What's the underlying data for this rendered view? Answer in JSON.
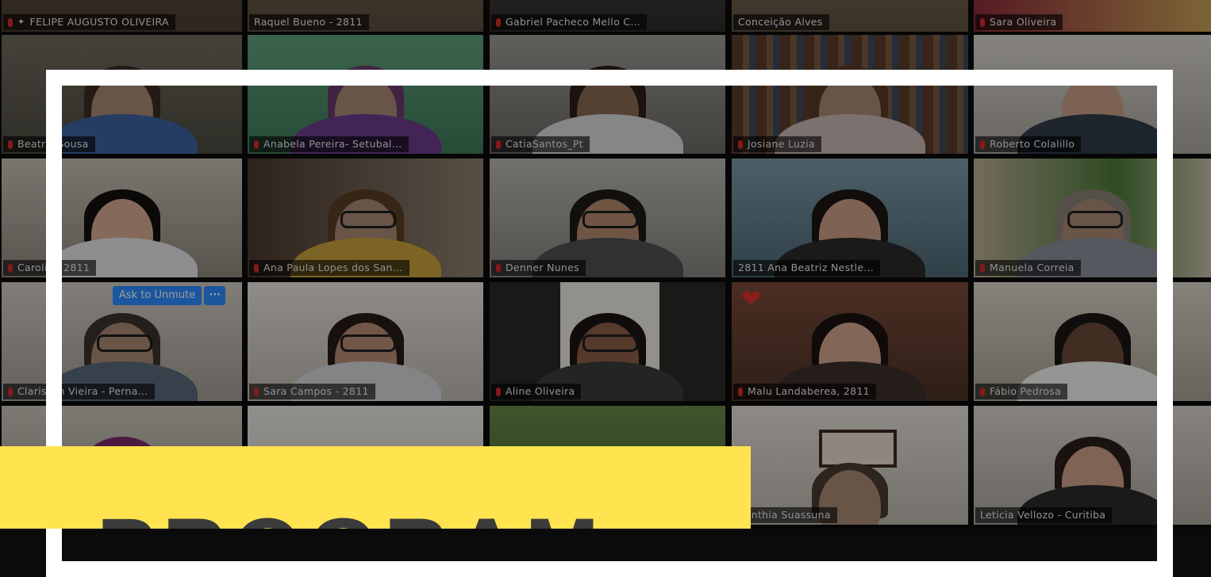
{
  "participants": [
    {
      "name": "FELIPE AUGUSTO OLIVEIRA",
      "muted": true,
      "pinned": true,
      "active": true
    },
    {
      "name": "Raquel Bueno - 2811",
      "muted": false
    },
    {
      "name": "Gabriel Pacheco Mello C...",
      "muted": true
    },
    {
      "name": "Conceição Alves",
      "muted": false
    },
    {
      "name": "Sara Oliveira",
      "muted": true
    },
    {
      "name": "Beatriz Sousa",
      "muted": true
    },
    {
      "name": "Anabela Pereira- Setubal...",
      "muted": true
    },
    {
      "name": "CatiaSantos_Pt",
      "muted": true
    },
    {
      "name": "Josiane Luzia",
      "muted": true
    },
    {
      "name": "Roberto Colalillo",
      "muted": true
    },
    {
      "name": "Carolina 2811",
      "muted": true
    },
    {
      "name": "Ana Paula Lopes dos San...",
      "muted": true
    },
    {
      "name": "Denner Nunes",
      "muted": true
    },
    {
      "name": "2811 Ana Beatriz Nestle...",
      "muted": false
    },
    {
      "name": "Manuela Correia",
      "muted": true
    },
    {
      "name": "Clarisson Vieira - Perna...",
      "muted": true
    },
    {
      "name": "Sara Campos - 2811",
      "muted": true
    },
    {
      "name": "Aline Oliveira",
      "muted": true
    },
    {
      "name": "Malu Landaberea, 2811",
      "muted": true
    },
    {
      "name": "Fábio Pedrosa",
      "muted": true
    },
    {
      "name": "",
      "muted": false
    },
    {
      "name": "",
      "muted": false
    },
    {
      "name": "",
      "muted": false
    },
    {
      "name": "Cynthia Suassuna",
      "muted": false
    },
    {
      "name": "Leticia Vellozo - Curitiba",
      "muted": false
    }
  ],
  "ask_to_unmute": {
    "label": "Ask to Unmute",
    "more": "···"
  },
  "reaction": {
    "icon": "heart-icon",
    "glyph": "❤"
  },
  "banner": {
    "title": "PROGRAM"
  },
  "colors": {
    "accent_yellow": "#ffe34f",
    "zoom_blue": "#2d8cff",
    "muted_red": "#d82a2a",
    "active_speaker": "#a5c03a"
  }
}
